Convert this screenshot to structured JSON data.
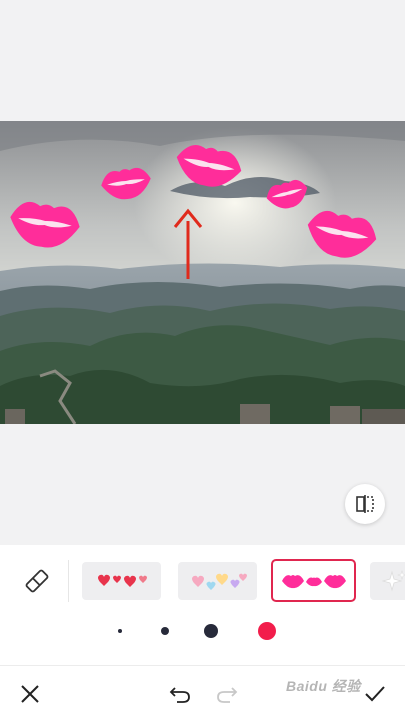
{
  "editor": {
    "photo_description_icon": "landscape-photo",
    "arrow_annotation_icon": "up-arrow-annotation",
    "compare_icon": "split-compare-icon"
  },
  "stickers": {
    "items": [
      {
        "name": "red-hearts",
        "icon": "hearts-red"
      },
      {
        "name": "pastel-hearts",
        "icon": "hearts-pastel"
      },
      {
        "name": "pink-lips",
        "icon": "lips-pink",
        "selected": true
      },
      {
        "name": "sparkles",
        "icon": "sparkle-white"
      }
    ]
  },
  "brush_sizes": {
    "options": [
      "extra-small",
      "small",
      "medium",
      "large"
    ],
    "selected": "large"
  },
  "colors": {
    "accent": "#e0264f",
    "active_dot": "#f21d4b",
    "dot": "#272a3a",
    "lips": "#ff2d9a"
  },
  "bottom_bar": {
    "close_icon": "close-icon",
    "undo_icon": "undo-icon",
    "redo_icon": "redo-icon",
    "confirm_icon": "check-icon",
    "watermark": "Baidu 经验"
  }
}
